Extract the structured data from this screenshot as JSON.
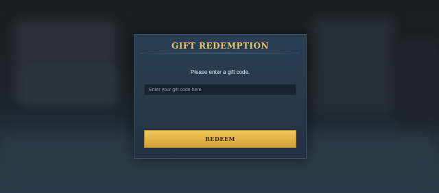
{
  "dialog": {
    "title": "GIFT REDEMPTION",
    "prompt": "Please enter a gift code.",
    "input_value": "",
    "input_placeholder": "Enter your gift code here",
    "redeem_label": "REDEEM"
  },
  "colors": {
    "title_gold": "#e8c46a",
    "button_gold": "#e2b447",
    "panel_blue": "#27384a"
  }
}
